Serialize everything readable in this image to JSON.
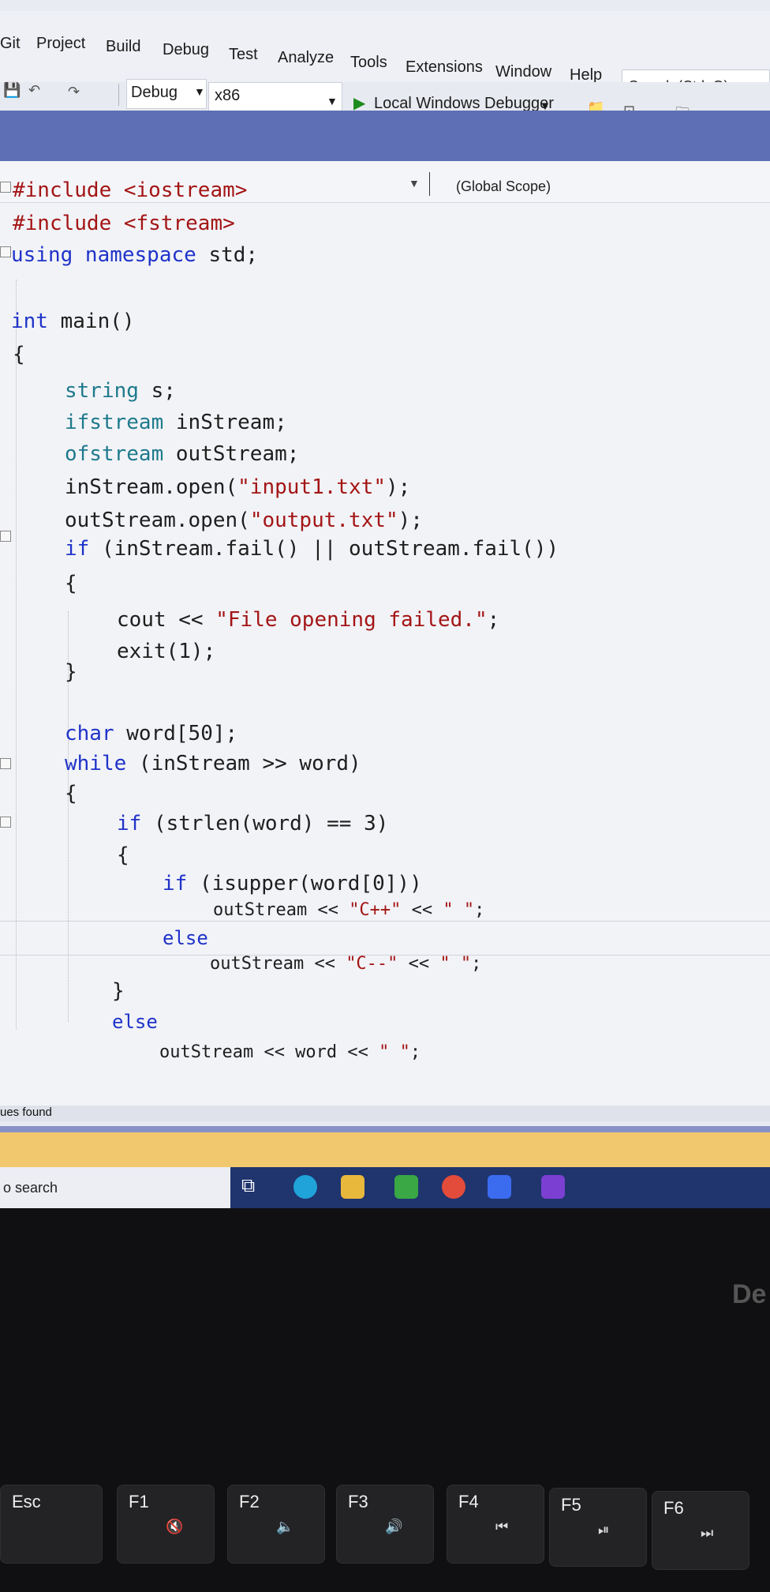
{
  "menu": [
    "Git",
    "Project",
    "Build",
    "Debug",
    "Test",
    "Analyze",
    "Tools",
    "Extensions",
    "Window",
    "Help"
  ],
  "search_placeholder": "Search (Ctrl+Q)",
  "toolbar": {
    "config": "Debug",
    "platform": "x86",
    "debugger": "Local Windows Debugger"
  },
  "scope": "(Global Scope)",
  "code": {
    "l1": "#include <iostream>",
    "l2": "#include <fstream>",
    "l3_kw": "using namespace",
    "l3_rest": " std;",
    "l4_kw": "int",
    "l4_rest": " main()",
    "l5": "{",
    "l6_ty": "string",
    "l6_rest": " s;",
    "l7_ty": "ifstream",
    "l7_rest": " inStream;",
    "l8_ty": "ofstream",
    "l8_rest": " outStream;",
    "l9_a": "inStream.open(",
    "l9_s": "\"input1.txt\"",
    "l9_b": ");",
    "l10_a": "outStream.open(",
    "l10_s": "\"output.txt\"",
    "l10_b": ");",
    "l11_kw": "if",
    "l11_rest": " (inStream.fail() || outStream.fail())",
    "l12": "{",
    "l13_a": "cout << ",
    "l13_s": "\"File opening failed.\"",
    "l13_b": ";",
    "l14": "exit(1);",
    "l15": "}",
    "l16_kw": "char",
    "l16_rest": " word[50];",
    "l17_kw": "while",
    "l17_rest": " (inStream >> word)",
    "l18": "{",
    "l19_kw": "if",
    "l19_rest": " (strlen(word) == 3)",
    "l20": "{",
    "l21_kw": "if",
    "l21_rest": " (isupper(word[0]))",
    "l22_a": "outStream << ",
    "l22_s": "\"C++\"",
    "l22_b": " << ",
    "l22_s2": "\" \"",
    "l22_c": ";",
    "l23_kw": "else",
    "l24_a": "outStream << ",
    "l24_s": "\"C--\"",
    "l24_b": " << ",
    "l24_s2": "\" \"",
    "l24_c": ";",
    "l25": "}",
    "l26_kw": "else",
    "l27_a": "outStream << word << ",
    "l27_s": "\" \"",
    "l27_c": ";"
  },
  "status": {
    "issues": "ues found"
  },
  "taskbar": {
    "search": "o search"
  },
  "keys": [
    {
      "main": "Esc",
      "sub": ""
    },
    {
      "main": "F1",
      "sub": "🔇"
    },
    {
      "main": "F2",
      "sub": "🔈"
    },
    {
      "main": "F3",
      "sub": "🔊"
    },
    {
      "main": "F4",
      "sub": "⏮"
    },
    {
      "main": "F5",
      "sub": "⏯"
    },
    {
      "main": "F6",
      "sub": "⏭"
    }
  ],
  "brand": "De"
}
